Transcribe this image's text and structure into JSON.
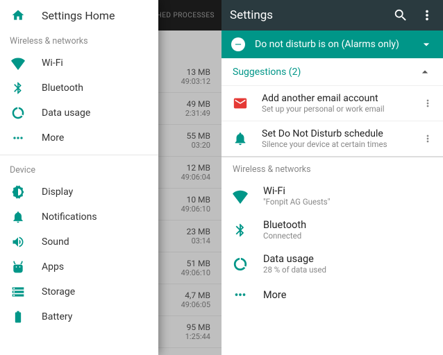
{
  "left": {
    "settings_home": "Settings Home",
    "wireless_section": "Wireless & networks",
    "wifi": "Wi-Fi",
    "bluetooth": "Bluetooth",
    "data_usage": "Data usage",
    "more": "More",
    "device_section": "Device",
    "display": "Display",
    "notifications": "Notifications",
    "sound": "Sound",
    "apps": "Apps",
    "storage": "Storage",
    "battery": "Battery",
    "bg_tab": "HED PROCESSES",
    "bg_rows": [
      {
        "mb": "13 MB",
        "tm": "49:03:12"
      },
      {
        "mb": "49 MB",
        "tm": "2:31:49"
      },
      {
        "mb": "55 MB",
        "tm": "03:20"
      },
      {
        "mb": "12 MB",
        "tm": "49:06:04"
      },
      {
        "mb": "10 MB",
        "tm": "49:06:10"
      },
      {
        "mb": "23 MB",
        "tm": "03:14"
      },
      {
        "mb": "51 MB",
        "tm": "49:06:10"
      },
      {
        "mb": "4,7 MB",
        "tm": "49:06:05"
      },
      {
        "mb": "95 MB",
        "tm": "1:25:44"
      }
    ]
  },
  "right": {
    "title": "Settings",
    "dnd": "Do not disturb is on (Alarms only)",
    "suggestions_label": "Suggestions (2)",
    "suggestions": [
      {
        "title": "Add another email account",
        "sub": "Set up your personal or work email"
      },
      {
        "title": "Set Do Not Disturb schedule",
        "sub": "Silence your device at certain times"
      }
    ],
    "wireless_section": "Wireless & networks",
    "wifi": {
      "title": "Wi-Fi",
      "sub": "\"Fonpit AG Guests\""
    },
    "bluetooth": {
      "title": "Bluetooth",
      "sub": "Connected"
    },
    "data_usage": {
      "title": "Data usage",
      "sub": "28 % of data used"
    },
    "more": {
      "title": "More"
    }
  }
}
